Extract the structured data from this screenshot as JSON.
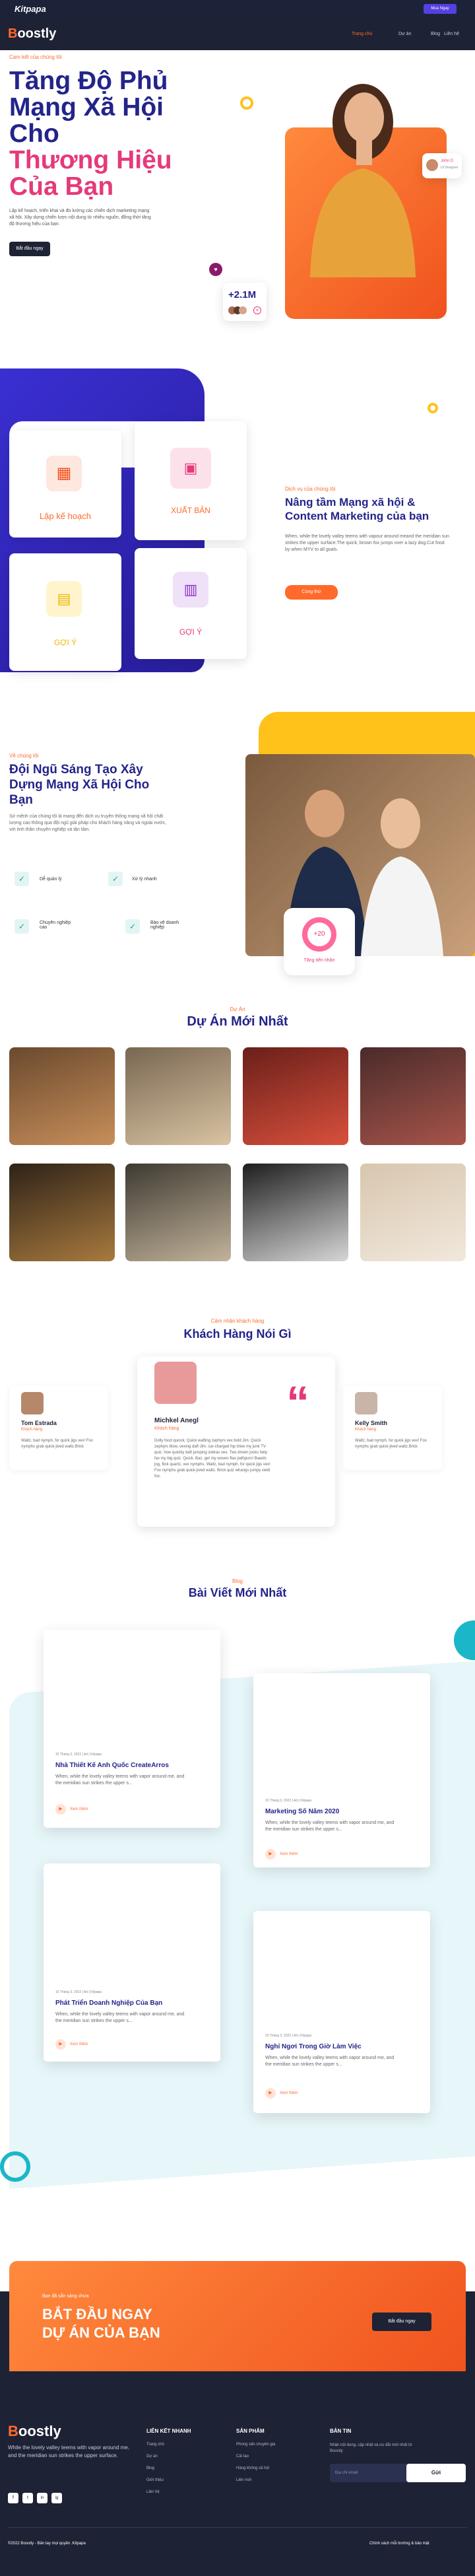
{
  "topbar": {
    "logo": "Kitpapa",
    "button": "Mua Ngay"
  },
  "nav": {
    "brand_prefix": "B",
    "brand_rest": "oostly",
    "links": [
      "Trang chủ",
      "Dự án",
      "Blog",
      "Liên hệ"
    ],
    "cta": "Mua Ngay"
  },
  "hero": {
    "subtitle": "Cam kết của chúng tôi",
    "title_line1": "Tăng Độ Phủ",
    "title_line2": "Mạng Xã Hội",
    "title_line3": "Cho",
    "title_line4": "Thương Hiệu",
    "title_line5": "Của Bạn",
    "description": "Lập kế hoạch, triển khai và đo lường các chiến dịch marketing mạng xã hội. Xây dựng chiến lược nội dung từ nhiều nguồn, đồng thời tăng độ thương hiệu của bạn.",
    "button": "Bắt đầu ngay",
    "stat": "+2.1M",
    "chip_name": "John D",
    "chip_role": "UI Designer"
  },
  "services": {
    "cards": [
      "Lập kế hoạch",
      "XUẤT BẢN",
      "GỢI Ý",
      "GỢI Ý"
    ],
    "subtitle": "Dịch vụ của chúng tôi",
    "title": "Nâng tầm Mạng xã hội & Content Marketing của bạn",
    "description": "When, while the lovely valley teems with vapour around meand the meridian sun strikes the upper surface.The quick, brown fox jumps over a lazy dog.Cut food by when MYV to all goals.",
    "button": "Cùng thử"
  },
  "team": {
    "subtitle": "Về chúng tôi",
    "title": "Đội Ngũ Sáng Tạo Xây Dựng Mạng Xã Hội Cho Bạn",
    "description": "Sứ mệnh của chúng tôi là mang đến dịch vụ truyền thông mạng xã hội chất lượng cao thông qua đội ngũ giải pháp cho khách hàng nâng và ngoài nước, với tinh thần chuyên nghiệp và tận tâm.",
    "features": [
      "Dễ quản lý",
      "Xử lý nhanh",
      "Chuyên nghiệp cao",
      "Bảo vệ doanh nghiệp"
    ],
    "badge_value": "+20",
    "badge_label": "Tăng tiến nhân"
  },
  "projects": {
    "subtitle": "Dự Án",
    "title": "Dự Án Mới Nhất"
  },
  "testimonials": {
    "subtitle": "Cảm nhận khách hàng",
    "title": "Khách Hàng Nói Gì",
    "items": [
      {
        "name": "Tom Estrada",
        "role": "Khách hàng",
        "text": "Waltz, bad nymph, for quick jigs vex! Fox nymphs grab quick-jived waltz.Brick"
      },
      {
        "name": "Michkel Anegl",
        "role": "Khách hàng",
        "text": "Dolly food quiock. Quick wafting zephyrs vex bold Jim. Quick zephyrs blow, vexing daft Jim. car-charged fop blew my junk TV quiz. how quickly daft jumping zebras vex. Two driven jocks help fax my big quiz. Quick, Baz, get my woven flax jodhpurs! Bawds jog, flick quartz, vex nymphs. Waltz, bad nymph, for quick jigs vex! Fox nymphs grab quick-jived waltz. Brick quiz whangs jumpy veldt fox."
      },
      {
        "name": "Kelly Smith",
        "role": "Khách hàng",
        "text": "Waltz, bad nymph, for quick jigs vex! Fox nymphs grab quick-jived waltz.Brick"
      }
    ]
  },
  "blog": {
    "subtitle": "Blog",
    "title": "Bài Viết Mới Nhất",
    "posts": [
      {
        "meta": "15 Tháng 3, 2022 | Ad | Kitpapa",
        "title": "Nhà Thiết Kế Anh Quốc CreateArros",
        "desc": "When, while the lovely valley teems with vapor around me, and the meridian sun strikes the upper s...",
        "more": "Xem thêm"
      },
      {
        "meta": "15 Tháng 3, 2022 | Ad | Kitpapa",
        "title": "Marketing Số Năm 2020",
        "desc": "When, while the lovely valley teems with vapor around me, and the meridian sun strikes the upper s...",
        "more": "Xem thêm"
      },
      {
        "meta": "15 Tháng 3, 2022 | Ad | Kitpapa",
        "title": "Phát Triển Doanh Nghiệp Của Bạn",
        "desc": "When, while the lovely valley teems with vapor around me, and the meridian sun strikes the upper s...",
        "more": "Xem thêm"
      },
      {
        "meta": "15 Tháng 3, 2022 | Ad | Kitpapa",
        "title": "Nghỉ Ngơi Trong Giờ Làm Việc",
        "desc": "When, while the lovely valley teems with vapor around me, and the meridian sun strikes the upper s...",
        "more": "Xem thêm"
      }
    ]
  },
  "cta": {
    "subtitle": "Bạn đã sẵn sàng chưa",
    "line1": "BẮT ĐẦU NGAY",
    "line2": "DỰ ÁN CỦA BẠN",
    "button": "Bắt đầu ngay"
  },
  "footer": {
    "brand_prefix": "B",
    "brand_rest": "oostly",
    "about": "While the lovely valley teems with vapor around me, and the meridian sun strikes the upper surface.",
    "col1_title": "LIÊN KẾT NHANH",
    "col1": [
      "Trang chủ",
      "Dự án",
      "Blog",
      "Giới thiệu",
      "Liên hệ"
    ],
    "col2_title": "SẢN PHẨM",
    "col2": [
      "Phòng vấn chuyên gia",
      "Cải tạo",
      "Hàng không xã hội",
      "Liên mới"
    ],
    "col3_title": "BẢN TIN",
    "col3_desc": "Nhận nội dung, cập nhật và ưu đãi mới nhất từ Boostly",
    "email_placeholder": "Địa chỉ email",
    "send": "Gửi",
    "copyright": "©2022 Boostly - Bản tay mọi quyền .Kitpapa",
    "terms": "Chính sách mỗi trường & bảo mật",
    "social": [
      "f",
      "t",
      "in",
      "ig"
    ]
  },
  "colors": {
    "brand": "#ff6a2b",
    "navy": "#1e2235",
    "title": "#23248a",
    "pink": "#e6397a"
  }
}
